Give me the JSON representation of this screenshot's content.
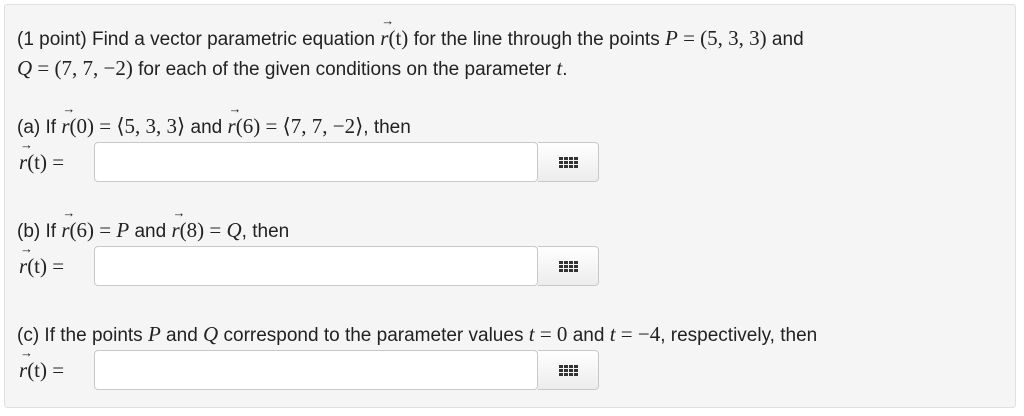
{
  "intro": {
    "part1": "(1 point) Find a vector parametric equation ",
    "r_func": "(t)",
    "part2": " for the line through the points ",
    "P_label": "P",
    "P_value": " = (5, 3, 3)",
    "part3": " and",
    "Q_label": "Q",
    "Q_value": " = (7, 7, −2)",
    "part4": " for each of the given conditions on the parameter ",
    "t": "t",
    "end": "."
  },
  "part_a": {
    "prefix": "(a) If ",
    "r0": "(0) = ⟨5, 3, 3⟩",
    "mid": " and ",
    "r6": "(6) = ⟨7, 7, −2⟩",
    "suffix": ", then"
  },
  "part_b": {
    "prefix": "(b) If ",
    "r6": "(6) = ",
    "P": "P",
    "mid": " and ",
    "r8": "(8) = ",
    "Q": "Q",
    "suffix": ", then"
  },
  "part_c": {
    "prefix": "(c) If the points ",
    "P": "P",
    "and1": " and ",
    "Q": "Q",
    "mid": " correspond to the parameter values ",
    "t1": "t",
    "eq1": " = 0",
    "and2": " and ",
    "t2": "t",
    "eq2": " = −4",
    "suffix": ", respectively, then"
  },
  "answer_label": "(t) =",
  "answers": {
    "a": "",
    "b": "",
    "c": ""
  },
  "icons": {
    "math_palette": "grid-icon"
  }
}
